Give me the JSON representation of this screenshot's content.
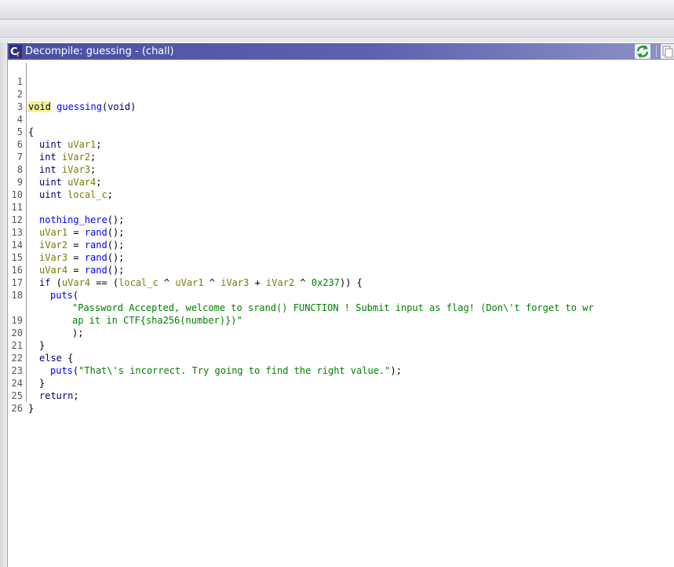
{
  "window": {
    "title": "Decompile: guessing -  (chall)",
    "icon": "decompiler-icon",
    "buttons": [
      {
        "name": "refresh",
        "icon": "refresh-icon"
      },
      {
        "name": "copy",
        "icon": "copy-icon"
      }
    ]
  },
  "colors": {
    "titlebar": "#4b4fa2",
    "keyword": "#000080",
    "function": "#0000ff",
    "variable": "#7b7b00",
    "string": "#008000",
    "highlight": "#f6f57f"
  },
  "code": {
    "line_numbers": [
      "1",
      "2",
      "3",
      "4",
      "5",
      "6",
      "7",
      "8",
      "9",
      "10",
      "11",
      "12",
      "13",
      "14",
      "15",
      "16",
      "17",
      "18",
      "",
      "19",
      "20",
      "21",
      "22",
      "23",
      "24",
      "25",
      "26"
    ],
    "tokens": {
      "l2": [
        "void",
        " ",
        "guessing",
        "(",
        "void",
        ")"
      ],
      "l4": [
        "{"
      ],
      "l5": [
        "uint",
        " ",
        "uVar1",
        ";"
      ],
      "l6": [
        "int",
        " ",
        "iVar2",
        ";"
      ],
      "l7": [
        "int",
        " ",
        "iVar3",
        ";"
      ],
      "l8": [
        "uint",
        " ",
        "uVar4",
        ";"
      ],
      "l9": [
        "uint",
        " ",
        "local_c",
        ";"
      ],
      "l11": [
        "nothing_here",
        "();"
      ],
      "l12": [
        "uVar1",
        " = ",
        "rand",
        "();"
      ],
      "l13": [
        "iVar2",
        " = ",
        "rand",
        "();"
      ],
      "l14": [
        "iVar3",
        " = ",
        "rand",
        "();"
      ],
      "l15": [
        "uVar4",
        " = ",
        "rand",
        "();"
      ],
      "l16": [
        "if",
        " (",
        "uVar4",
        " == (",
        "local_c",
        " ^ ",
        "uVar1",
        " ^ ",
        "iVar3",
        " + ",
        "iVar2",
        " ^ ",
        "0x237",
        ")) {"
      ],
      "l17": [
        "puts",
        "("
      ],
      "l18a": [
        "\"Password Accepted, welcome to srand() FUNCTION ! Submit input as flag! (Don\\'t forget to wr"
      ],
      "l18b": [
        "ap it in CTF{sha256(number)})\""
      ],
      "l19": [
        ");"
      ],
      "l20": [
        "}"
      ],
      "l21": [
        "else",
        " {"
      ],
      "l22": [
        "puts",
        "(",
        "\"That\\'s incorrect. Try going to find the right value.\"",
        ");"
      ],
      "l23": [
        "}"
      ],
      "l24": [
        "return",
        ";"
      ],
      "l25": [
        "}"
      ]
    }
  }
}
